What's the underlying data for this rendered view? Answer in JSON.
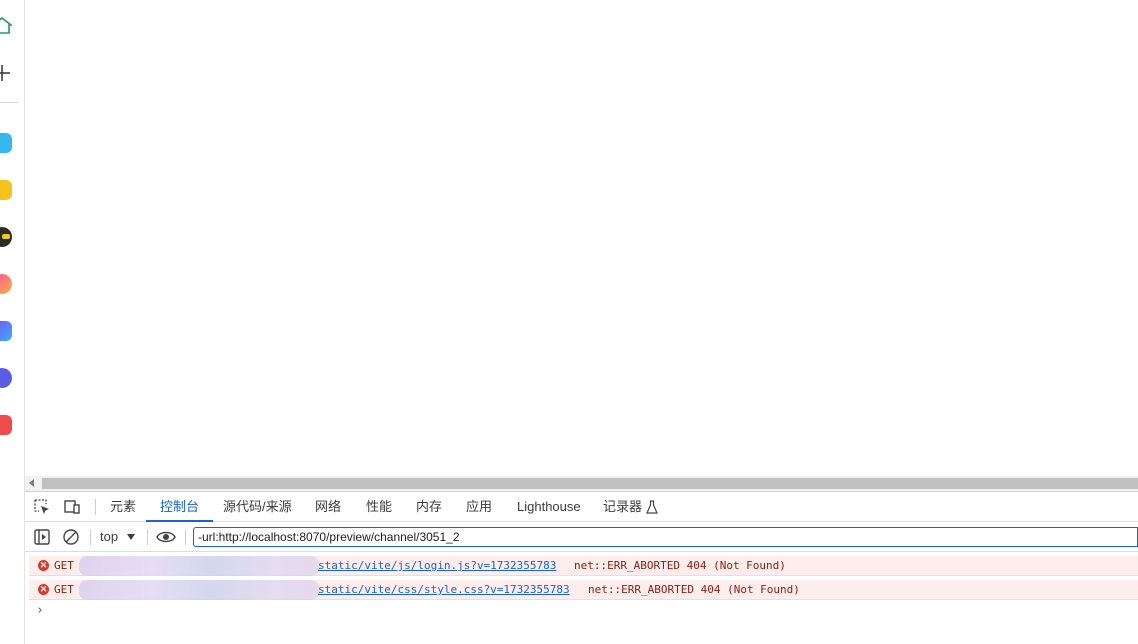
{
  "devtools": {
    "tabs": [
      "元素",
      "控制台",
      "源代码/来源",
      "网络",
      "性能",
      "内存",
      "应用",
      "Lighthouse",
      "记录器"
    ],
    "active_tab": "控制台",
    "context": "top",
    "filter_value": "-url:http://localhost:8070/preview/channel/3051_2",
    "logs": [
      {
        "method": "GET",
        "url": "static/vite/js/login.js?v=1732355783",
        "message": "net::ERR_ABORTED 404 (Not Found)"
      },
      {
        "method": "GET",
        "url": "static/vite/css/style.css?v=1732355783",
        "message": "net::ERR_ABORTED 404 (Not Found)"
      }
    ],
    "prompt": "›",
    "colors": {
      "accent": "#1a62d9",
      "error_bg": "#fdeded",
      "error_text": "#8a1f11"
    }
  },
  "sidebar": {
    "icons": [
      "home-icon",
      "new-tab-icon",
      "app-icon-blue",
      "app-icon-star",
      "app-icon-robot",
      "app-icon-ai",
      "app-icon-ai-purple",
      "app-icon-chat",
      "app-icon-game"
    ]
  }
}
